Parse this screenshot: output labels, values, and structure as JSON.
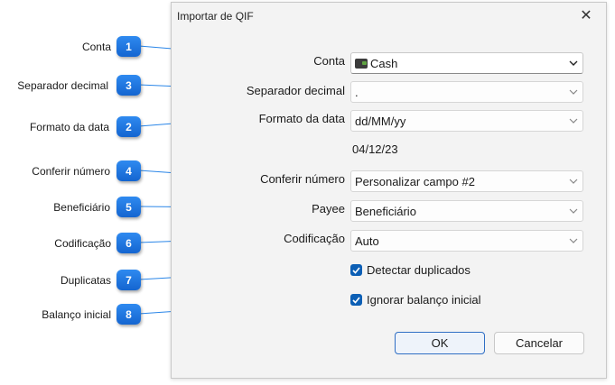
{
  "dialog": {
    "title": "Importar de QIF",
    "close_glyph": "✕",
    "fields": {
      "conta": {
        "label": "Conta",
        "value": "Cash",
        "icon": "wallet-icon"
      },
      "separador": {
        "label": "Separador decimal",
        "value": "."
      },
      "formato": {
        "label": "Formato da data",
        "value": "dd/MM/yy"
      },
      "date_preview": "04/12/23",
      "conferir": {
        "label": "Conferir número",
        "value": "Personalizar campo #2"
      },
      "payee": {
        "label": "Payee",
        "value": "Beneficiário"
      },
      "codificacao": {
        "label": "Codificação",
        "value": "Auto"
      }
    },
    "checkboxes": {
      "duplicados": {
        "label": "Detectar duplicados",
        "checked": true
      },
      "balanco": {
        "label": "Ignorar balanço inicial",
        "checked": true
      }
    },
    "buttons": {
      "ok": "OK",
      "cancel": "Cancelar"
    }
  },
  "callouts": [
    {
      "num": "1",
      "label": "Conta"
    },
    {
      "num": "3",
      "label": "Separador decimal"
    },
    {
      "num": "2",
      "label": "Formato da data"
    },
    {
      "num": "4",
      "label": "Conferir número"
    },
    {
      "num": "5",
      "label": "Beneficiário"
    },
    {
      "num": "6",
      "label": "Codificação"
    },
    {
      "num": "7",
      "label": "Duplicatas"
    },
    {
      "num": "8",
      "label": "Balanço inicial"
    }
  ],
  "colors": {
    "badge": "#1e74e0",
    "connector": "#2a86e8",
    "checkbox": "#0c5fb5",
    "ok_border": "#2f6ec4"
  }
}
